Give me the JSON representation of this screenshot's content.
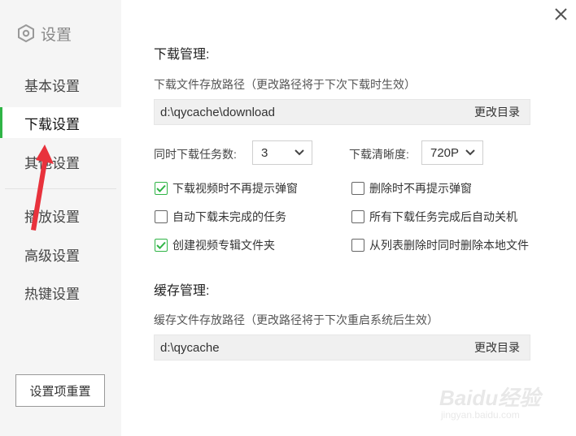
{
  "sidebar": {
    "title": "设置",
    "items": [
      {
        "label": "基本设置"
      },
      {
        "label": "下载设置"
      },
      {
        "label": "其他设置"
      },
      {
        "label": "播放设置"
      },
      {
        "label": "高级设置"
      },
      {
        "label": "热键设置"
      }
    ],
    "reset_label": "设置项重置"
  },
  "download": {
    "section_title": "下载管理:",
    "path_label": "下载文件存放路径（更改路径将于下次下载时生效）",
    "path_value": "d:\\qycache\\download",
    "change_dir_label": "更改目录",
    "concurrent_label": "同时下载任务数:",
    "concurrent_value": "3",
    "quality_label": "下载清晰度:",
    "quality_value": "720P",
    "options": [
      {
        "label": "下载视频时不再提示弹窗",
        "checked": true
      },
      {
        "label": "删除时不再提示弹窗",
        "checked": false
      },
      {
        "label": "自动下载未完成的任务",
        "checked": false
      },
      {
        "label": "所有下载任务完成后自动关机",
        "checked": false
      },
      {
        "label": "创建视频专辑文件夹",
        "checked": true
      },
      {
        "label": "从列表删除时同时删除本地文件",
        "checked": false
      }
    ]
  },
  "cache": {
    "section_title": "缓存管理:",
    "path_label": "缓存文件存放路径（更改路径将于下次重启系统后生效）",
    "path_value": "d:\\qycache",
    "change_dir_label": "更改目录"
  },
  "watermark": {
    "text": "Baidu经验",
    "sub": "jingyan.baidu.com"
  },
  "colors": {
    "accent": "#2fb446",
    "arrow": "#e8323c",
    "sidebar_bg": "#f5f5f5"
  }
}
